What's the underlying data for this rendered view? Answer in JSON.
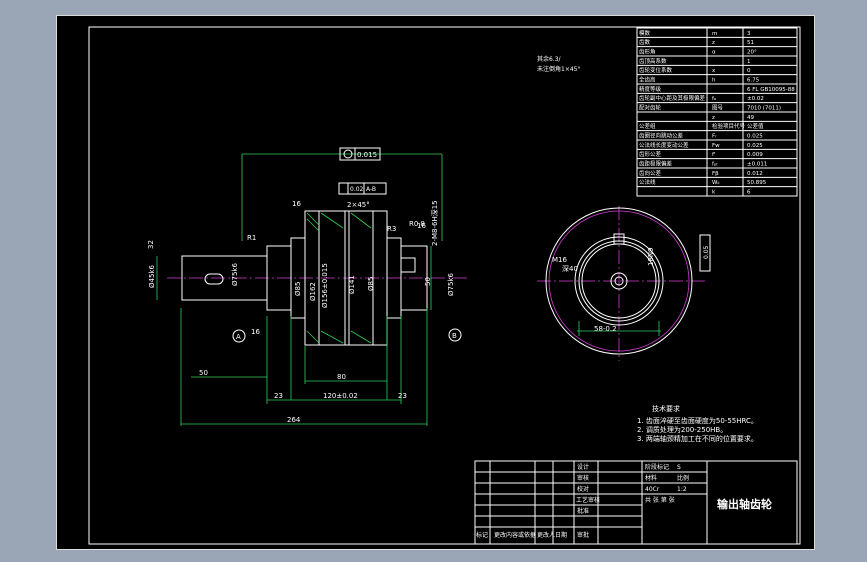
{
  "params_table": {
    "rows": [
      {
        "name": "模数",
        "sym": "m",
        "val": "3"
      },
      {
        "name": "齿数",
        "sym": "z",
        "val": "51"
      },
      {
        "name": "齿形角",
        "sym": "α",
        "val": "20°"
      },
      {
        "name": "齿顶高系数",
        "sym": "",
        "val": "1"
      },
      {
        "name": "齿轮变位系数",
        "sym": "x",
        "val": "0"
      },
      {
        "name": "全齿高",
        "sym": "h",
        "val": "6.75"
      },
      {
        "name": "精度等级",
        "sym": "",
        "val": "6 FL GB10095-88"
      },
      {
        "name": "齿轮副中心距及其极限偏差",
        "sym": "fₐ",
        "val": "±0.02"
      },
      {
        "name": "配对齿轮",
        "sym": "图号",
        "val": "7010 (7011)"
      },
      {
        "name": "",
        "sym": "z",
        "val": "49"
      },
      {
        "name": "公差组",
        "sym": "检验项目代号",
        "val": "公差值"
      },
      {
        "name": "齿圈径向跳动公差",
        "sym": "Fᵣ",
        "val": "0.025"
      },
      {
        "name": "公法线长度变动公差",
        "sym": "Fw",
        "val": "0.025"
      },
      {
        "name": "齿形公差",
        "sym": "fᶠ",
        "val": "0.009"
      },
      {
        "name": "齿距极限偏差",
        "sym": "fₚₜ",
        "val": "±0.011"
      },
      {
        "name": "齿向公差",
        "sym": "Fβ",
        "val": "0.012"
      },
      {
        "name": "公法线",
        "sym": "Wₖ",
        "val": "50.895"
      },
      {
        "name": "",
        "sym": "k",
        "val": "6"
      }
    ]
  },
  "notes_top": {
    "line1": "其余6.3/",
    "line2": "未注倒角1×45°"
  },
  "tech_req": {
    "title": "技术要求",
    "items": [
      "1. 齿面淬硬至齿面硬度为50-55HRC。",
      "2. 调质处理为200-250HB。",
      "3. 两端轴颈精加工在不同的位置要求。"
    ]
  },
  "dims": {
    "d_45k6": "Ø45k6",
    "d_75k6a": "Ø75k6",
    "d_85a": "Ø85",
    "d_162": "Ø162",
    "d_156": "Ø156±0.015",
    "d_141": "Ø141",
    "d_85b": "Ø85",
    "d_75k6b": "Ø75k6",
    "r1": "R1",
    "r3": "R3",
    "r08": "R0.8",
    "m8": "2-M8-6H深15",
    "ch2": "2×45°",
    "ch3": "2×45°",
    "runout": "0.015",
    "flat": "0.02",
    "datum_ab": "A-B",
    "l80": "80",
    "l120": "120±0.02",
    "l23a": "23",
    "l23b": "23",
    "l264": "264",
    "l50": "50",
    "l50b": "50",
    "l32": "32",
    "r16a": "16",
    "r16b": "16",
    "datumA": "A",
    "datumB": "B",
    "side_m16": "M16",
    "side_deep": "深40",
    "side_key": "18N9",
    "side_58": "58-0.2",
    "side_tol": "0.05"
  },
  "title_block": {
    "part_name": "输出轴齿轮",
    "material_label": "材料",
    "material": "40Cr",
    "scale_label": "比例",
    "scale": "1:2",
    "sheet_label": "共 张 第 张",
    "rows": [
      "设计",
      "审核",
      "校对",
      "工艺审核",
      "批准"
    ],
    "bottom": [
      "标记",
      "更改内容或依据",
      "更改人",
      "日期",
      "审批"
    ],
    "drawing_label": "阶段标记",
    "ss": "S"
  }
}
